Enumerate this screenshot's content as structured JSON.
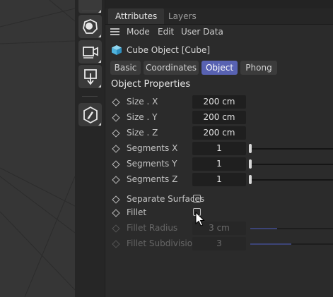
{
  "panel": {
    "tabs": [
      {
        "label": "Attributes",
        "active": true
      },
      {
        "label": "Layers",
        "active": false
      }
    ],
    "menu": [
      "Mode",
      "Edit",
      "User Data"
    ],
    "object_title": "Cube Object [Cube]",
    "subtabs": [
      {
        "label": "Basic",
        "active": false
      },
      {
        "label": "Coordinates",
        "active": false
      },
      {
        "label": "Object",
        "active": true
      },
      {
        "label": "Phong",
        "active": false
      }
    ],
    "section_title": "Object Properties",
    "props": {
      "size_x": {
        "label": "Size . X",
        "value": "200 cm"
      },
      "size_y": {
        "label": "Size . Y",
        "value": "200 cm"
      },
      "size_z": {
        "label": "Size . Z",
        "value": "200 cm"
      },
      "seg_x": {
        "label": "Segments X",
        "value": "1"
      },
      "seg_y": {
        "label": "Segments Y",
        "value": "1"
      },
      "seg_z": {
        "label": "Segments Z",
        "value": "1"
      },
      "separate_surfaces": {
        "label": "Separate Surfaces",
        "checked": false
      },
      "fillet": {
        "label": "Fillet",
        "checked": false
      },
      "fillet_radius": {
        "label": "Fillet Radius",
        "value": "3 cm",
        "enabled": false
      },
      "fillet_subdivision": {
        "label": "Fillet Subdivision",
        "value": "3",
        "enabled": false
      }
    }
  },
  "toolbar": {
    "icons": [
      "selection-tool-icon",
      "plane-subdivision-icon",
      "camera-icon",
      "floor-icon",
      "edit-object-icon"
    ]
  },
  "colors": {
    "accent": "#5862b2",
    "panel_bg": "#2b2b2b",
    "field_bg": "#1f1f1f"
  }
}
